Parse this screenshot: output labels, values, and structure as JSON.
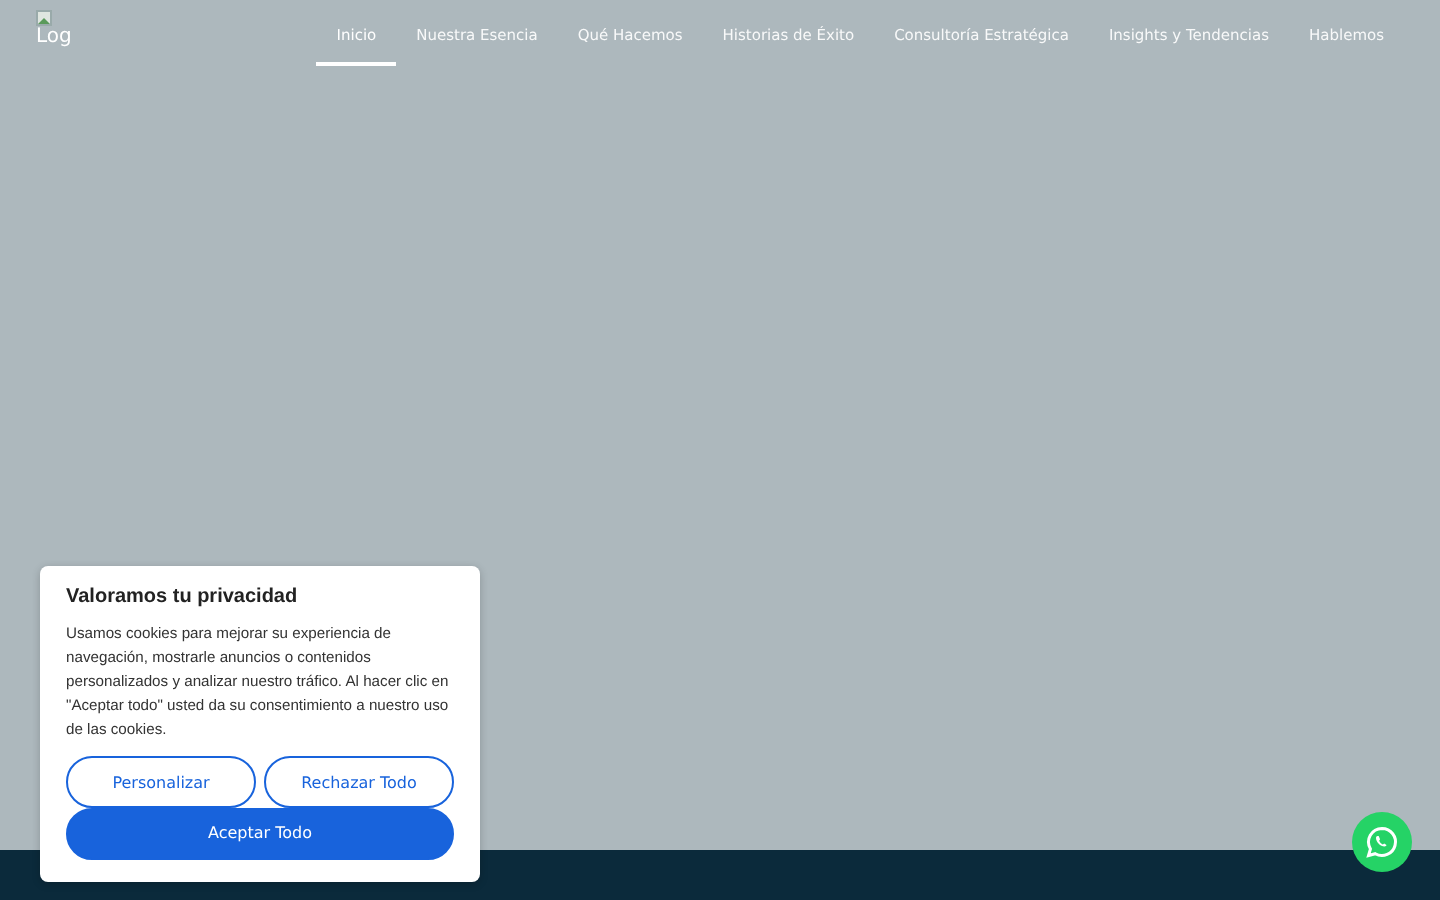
{
  "header": {
    "logo_text": "Log",
    "nav": [
      {
        "label": "Inicio",
        "selected": true
      },
      {
        "label": "Nuestra Esencia",
        "selected": false
      },
      {
        "label": "Qué Hacemos",
        "selected": false
      },
      {
        "label": "Historias de Éxito",
        "selected": false
      },
      {
        "label": "Consultoría Estratégica",
        "selected": false
      },
      {
        "label": "Insights y Tendencias",
        "selected": false
      },
      {
        "label": "Hablemos",
        "selected": false
      }
    ]
  },
  "cookie_banner": {
    "title": "Valoramos tu privacidad",
    "text": "Usamos cookies para mejorar su experiencia de navegación, mostrarle anuncios o contenidos personalizados y analizar nuestro tráfico. Al hacer clic en \"Aceptar todo\" usted da su consentimiento a nuestro uso de las cookies.",
    "buttons": [
      {
        "label": "Personalizar",
        "kind": "outline"
      },
      {
        "label": "Rechazar Todo",
        "kind": "outline"
      },
      {
        "label": "Aceptar Todo",
        "kind": "primary"
      }
    ]
  }
}
